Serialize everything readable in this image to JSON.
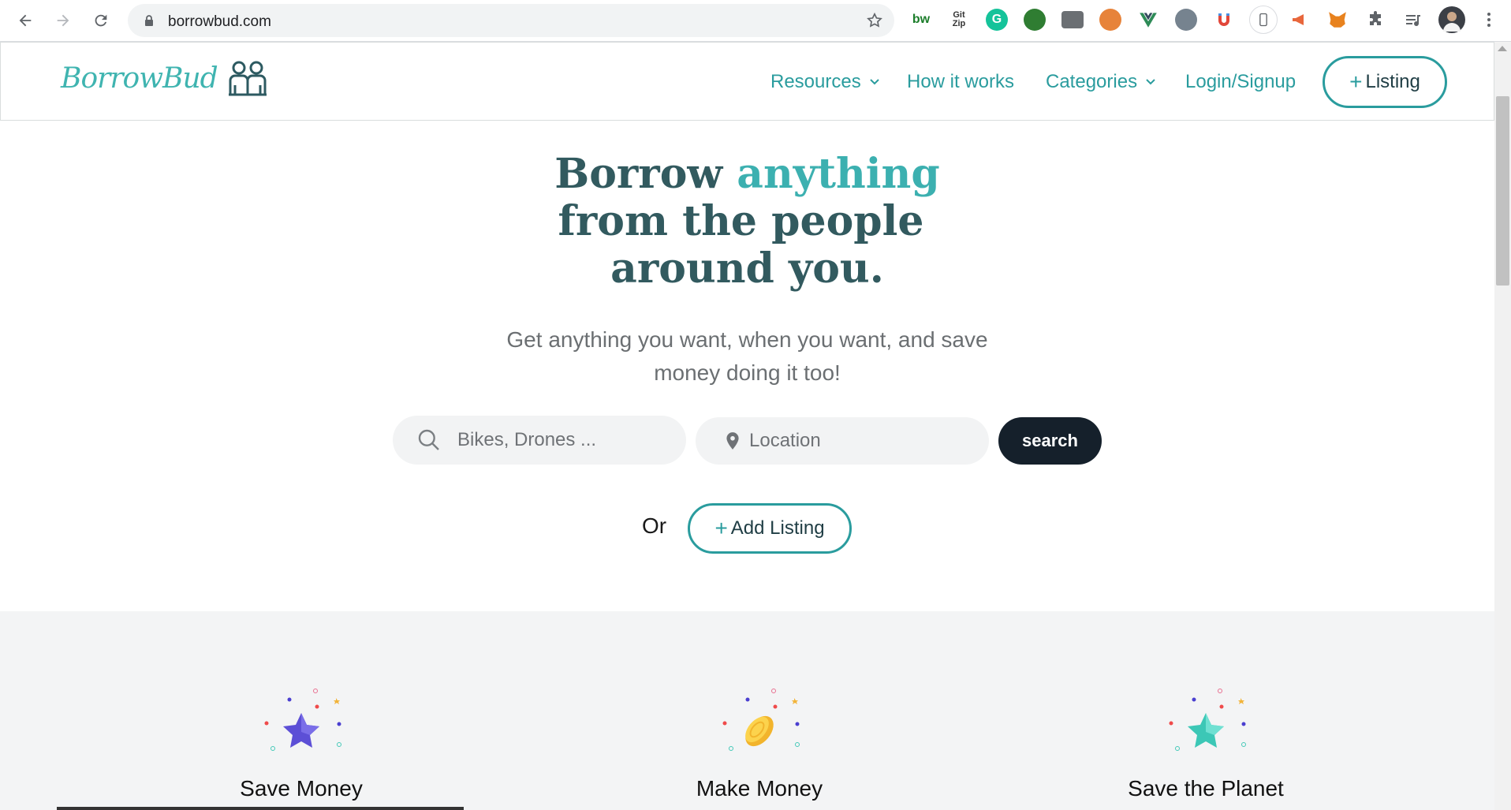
{
  "browser": {
    "url": "borrowbud.com",
    "extensions": [
      "bw-icon",
      "gitzip-icon",
      "grammarly-icon",
      "globe-icon",
      "window-icon",
      "color-icon",
      "vue-icon",
      "ring-icon",
      "magnet-icon",
      "phone-icon",
      "megaphone-icon",
      "fox-icon",
      "puzzle-icon",
      "playlist-icon",
      "avatar"
    ]
  },
  "header": {
    "logo_text": "BorrowBud",
    "nav": {
      "resources": "Resources",
      "how_it_works": "How it works",
      "categories": "Categories",
      "login": "Login/Signup"
    },
    "listing_plus": "+",
    "listing_label": "Listing"
  },
  "hero": {
    "title_word1": "Borrow",
    "title_accent": "anything",
    "title_line2": "from the people",
    "title_line3": "around you.",
    "subtitle_line1": "Get anything you want, when you want, and save",
    "subtitle_line2": "money doing it too!"
  },
  "search": {
    "item_placeholder": "Bikes, Drones ...",
    "location_placeholder": "Location",
    "button": "search"
  },
  "or_text": "Or",
  "add_listing": {
    "plus": "+",
    "label": "Add Listing"
  },
  "features": [
    {
      "label": "Save Money",
      "icon": "purple-star-icon"
    },
    {
      "label": "Make Money",
      "icon": "gold-coin-icon"
    },
    {
      "label": "Save the Planet",
      "icon": "teal-star-icon"
    }
  ],
  "colors": {
    "brand_teal": "#2a9c9e",
    "heading_dark": "#325a5f",
    "search_button": "#15202b"
  }
}
